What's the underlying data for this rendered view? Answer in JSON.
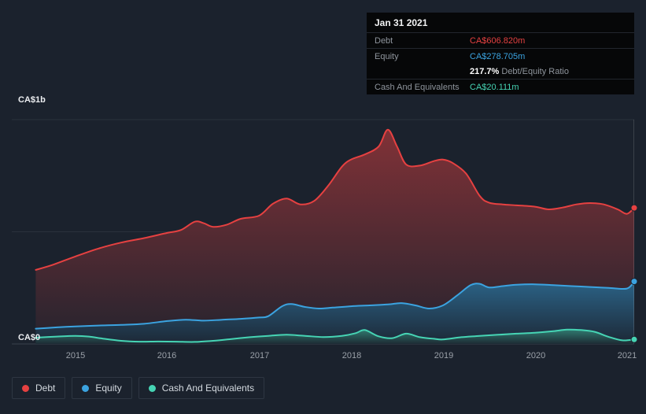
{
  "page": {
    "bg": "#1b222d"
  },
  "tooltip": {
    "date": "Jan 31 2021",
    "debt_label": "Debt",
    "debt_value": "CA$606.820m",
    "equity_label": "Equity",
    "equity_value": "CA$278.705m",
    "ratio_value": "217.7%",
    "ratio_label": " Debt/Equity Ratio",
    "cash_label": "Cash And Equivalents",
    "cash_value": "CA$20.111m"
  },
  "axis": {
    "y_top_label": "CA$1b",
    "y_zero_label": "CA$0",
    "x_ticks": [
      "2015",
      "2016",
      "2017",
      "2018",
      "2019",
      "2020",
      "2021"
    ]
  },
  "legend": {
    "items": [
      {
        "label": "Debt",
        "color": "#e64141"
      },
      {
        "label": "Equity",
        "color": "#3ba3e0"
      },
      {
        "label": "Cash And Equivalents",
        "color": "#46d4b4"
      }
    ]
  },
  "chart_data": {
    "type": "area",
    "unit": "CA$ millions",
    "ylim": [
      0,
      1000
    ],
    "y_gridlines": [
      0,
      500,
      1000
    ],
    "y_tick_labels": {
      "0": "CA$0",
      "1000": "CA$1b"
    },
    "x_range": [
      2014.31,
      2021.08
    ],
    "x_ticks": [
      2015,
      2016,
      2017,
      2018,
      2019,
      2020,
      2021
    ],
    "legend_position": "bottom-left",
    "hover_point": {
      "date": "Jan 31 2021",
      "debt_m": 606.82,
      "equity_m": 278.705,
      "cash_and_equivalents_m": 20.111,
      "debt_equity_ratio_pct": 217.7
    },
    "series": [
      {
        "name": "Debt",
        "color": "#e64141",
        "points": [
          [
            2014.57,
            330
          ],
          [
            2014.75,
            352
          ],
          [
            2015.0,
            390
          ],
          [
            2015.25,
            425
          ],
          [
            2015.5,
            452
          ],
          [
            2015.75,
            472
          ],
          [
            2016.0,
            495
          ],
          [
            2016.15,
            508
          ],
          [
            2016.3,
            545
          ],
          [
            2016.4,
            538
          ],
          [
            2016.5,
            522
          ],
          [
            2016.65,
            532
          ],
          [
            2016.8,
            558
          ],
          [
            2017.0,
            572
          ],
          [
            2017.15,
            625
          ],
          [
            2017.3,
            648
          ],
          [
            2017.45,
            622
          ],
          [
            2017.6,
            638
          ],
          [
            2017.75,
            705
          ],
          [
            2017.9,
            790
          ],
          [
            2018.0,
            822
          ],
          [
            2018.15,
            845
          ],
          [
            2018.3,
            880
          ],
          [
            2018.4,
            955
          ],
          [
            2018.5,
            880
          ],
          [
            2018.6,
            800
          ],
          [
            2018.75,
            795
          ],
          [
            2018.9,
            815
          ],
          [
            2019.0,
            822
          ],
          [
            2019.1,
            808
          ],
          [
            2019.25,
            760
          ],
          [
            2019.4,
            660
          ],
          [
            2019.5,
            630
          ],
          [
            2019.65,
            622
          ],
          [
            2019.8,
            618
          ],
          [
            2020.0,
            612
          ],
          [
            2020.15,
            600
          ],
          [
            2020.3,
            608
          ],
          [
            2020.45,
            622
          ],
          [
            2020.6,
            628
          ],
          [
            2020.75,
            622
          ],
          [
            2020.9,
            600
          ],
          [
            2021.0,
            580
          ],
          [
            2021.08,
            606.82
          ]
        ]
      },
      {
        "name": "Equity",
        "color": "#3ba3e0",
        "points": [
          [
            2014.57,
            68
          ],
          [
            2014.8,
            74
          ],
          [
            2015.0,
            78
          ],
          [
            2015.25,
            82
          ],
          [
            2015.5,
            85
          ],
          [
            2015.75,
            90
          ],
          [
            2016.0,
            102
          ],
          [
            2016.2,
            108
          ],
          [
            2016.4,
            104
          ],
          [
            2016.6,
            108
          ],
          [
            2016.8,
            112
          ],
          [
            2017.0,
            118
          ],
          [
            2017.1,
            124
          ],
          [
            2017.25,
            168
          ],
          [
            2017.35,
            178
          ],
          [
            2017.5,
            165
          ],
          [
            2017.65,
            158
          ],
          [
            2017.8,
            162
          ],
          [
            2018.0,
            168
          ],
          [
            2018.2,
            172
          ],
          [
            2018.4,
            176
          ],
          [
            2018.55,
            182
          ],
          [
            2018.7,
            172
          ],
          [
            2018.85,
            158
          ],
          [
            2019.0,
            172
          ],
          [
            2019.15,
            215
          ],
          [
            2019.3,
            262
          ],
          [
            2019.4,
            268
          ],
          [
            2019.5,
            252
          ],
          [
            2019.65,
            258
          ],
          [
            2019.8,
            264
          ],
          [
            2020.0,
            266
          ],
          [
            2020.2,
            262
          ],
          [
            2020.4,
            258
          ],
          [
            2020.6,
            254
          ],
          [
            2020.8,
            250
          ],
          [
            2021.0,
            247
          ],
          [
            2021.08,
            278.705
          ]
        ]
      },
      {
        "name": "Cash And Equivalents",
        "color": "#46d4b4",
        "points": [
          [
            2014.57,
            28
          ],
          [
            2014.8,
            33
          ],
          [
            2015.0,
            36
          ],
          [
            2015.15,
            33
          ],
          [
            2015.3,
            24
          ],
          [
            2015.5,
            14
          ],
          [
            2015.7,
            10
          ],
          [
            2015.9,
            11
          ],
          [
            2016.1,
            10
          ],
          [
            2016.3,
            9
          ],
          [
            2016.5,
            14
          ],
          [
            2016.7,
            22
          ],
          [
            2016.9,
            30
          ],
          [
            2017.1,
            36
          ],
          [
            2017.3,
            41
          ],
          [
            2017.5,
            36
          ],
          [
            2017.7,
            31
          ],
          [
            2017.9,
            36
          ],
          [
            2018.05,
            48
          ],
          [
            2018.15,
            62
          ],
          [
            2018.3,
            34
          ],
          [
            2018.45,
            26
          ],
          [
            2018.6,
            46
          ],
          [
            2018.75,
            30
          ],
          [
            2018.9,
            23
          ],
          [
            2019.0,
            20
          ],
          [
            2019.2,
            30
          ],
          [
            2019.4,
            36
          ],
          [
            2019.6,
            41
          ],
          [
            2019.8,
            46
          ],
          [
            2020.0,
            50
          ],
          [
            2020.2,
            57
          ],
          [
            2020.35,
            64
          ],
          [
            2020.5,
            62
          ],
          [
            2020.65,
            54
          ],
          [
            2020.8,
            32
          ],
          [
            2020.95,
            16
          ],
          [
            2021.08,
            20.111
          ]
        ]
      }
    ]
  }
}
